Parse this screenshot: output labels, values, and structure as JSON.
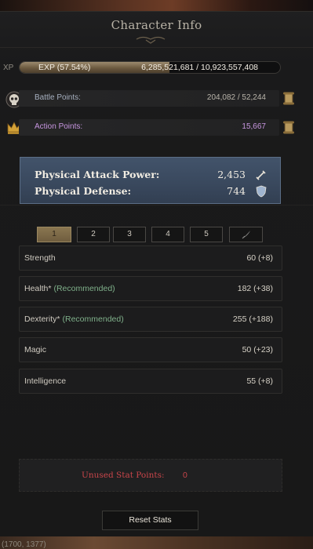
{
  "window": {
    "title": "Character Info"
  },
  "experience": {
    "label": "XP",
    "percent_text": "EXP (57.54%)",
    "values_text": "6,285,521,681 / 10,923,557,408",
    "fill_fraction": 0.5754,
    "bar_color": "#8c7a5c"
  },
  "points": [
    {
      "label": "Battle Points:",
      "value": "204,082 / 52,244",
      "icon": "skull-icon"
    },
    {
      "label": "Action Points:",
      "value": "15,667",
      "icon": "crown-icon",
      "color": "#c796e0"
    }
  ],
  "combat": {
    "attack_label": "Physical Attack Power:",
    "attack_value": "2,453",
    "defense_label": "Physical Defense:",
    "defense_value": "744"
  },
  "presets": {
    "tabs": [
      "1",
      "2",
      "3",
      "4",
      "5"
    ],
    "active_tab": "1",
    "edit_icon": "quill-icon"
  },
  "stats": [
    {
      "name": "Strength",
      "recommended": "",
      "value": "60 (+8)"
    },
    {
      "name": "Health*",
      "recommended": "(Recommended)",
      "value": "182 (+38)"
    },
    {
      "name": "Dexterity*",
      "recommended": "(Recommended)",
      "value": "255 (+188)"
    },
    {
      "name": "Magic",
      "recommended": "",
      "value": "50 (+23)"
    },
    {
      "name": "Intelligence",
      "recommended": "",
      "value": "55 (+8)"
    }
  ],
  "unused": {
    "label": "Unused Stat Points:",
    "value": "0",
    "color": "#c9454a"
  },
  "buttons": {
    "reset": "Reset Stats"
  },
  "footer": {
    "coordinates": "(1700, 1377)"
  }
}
